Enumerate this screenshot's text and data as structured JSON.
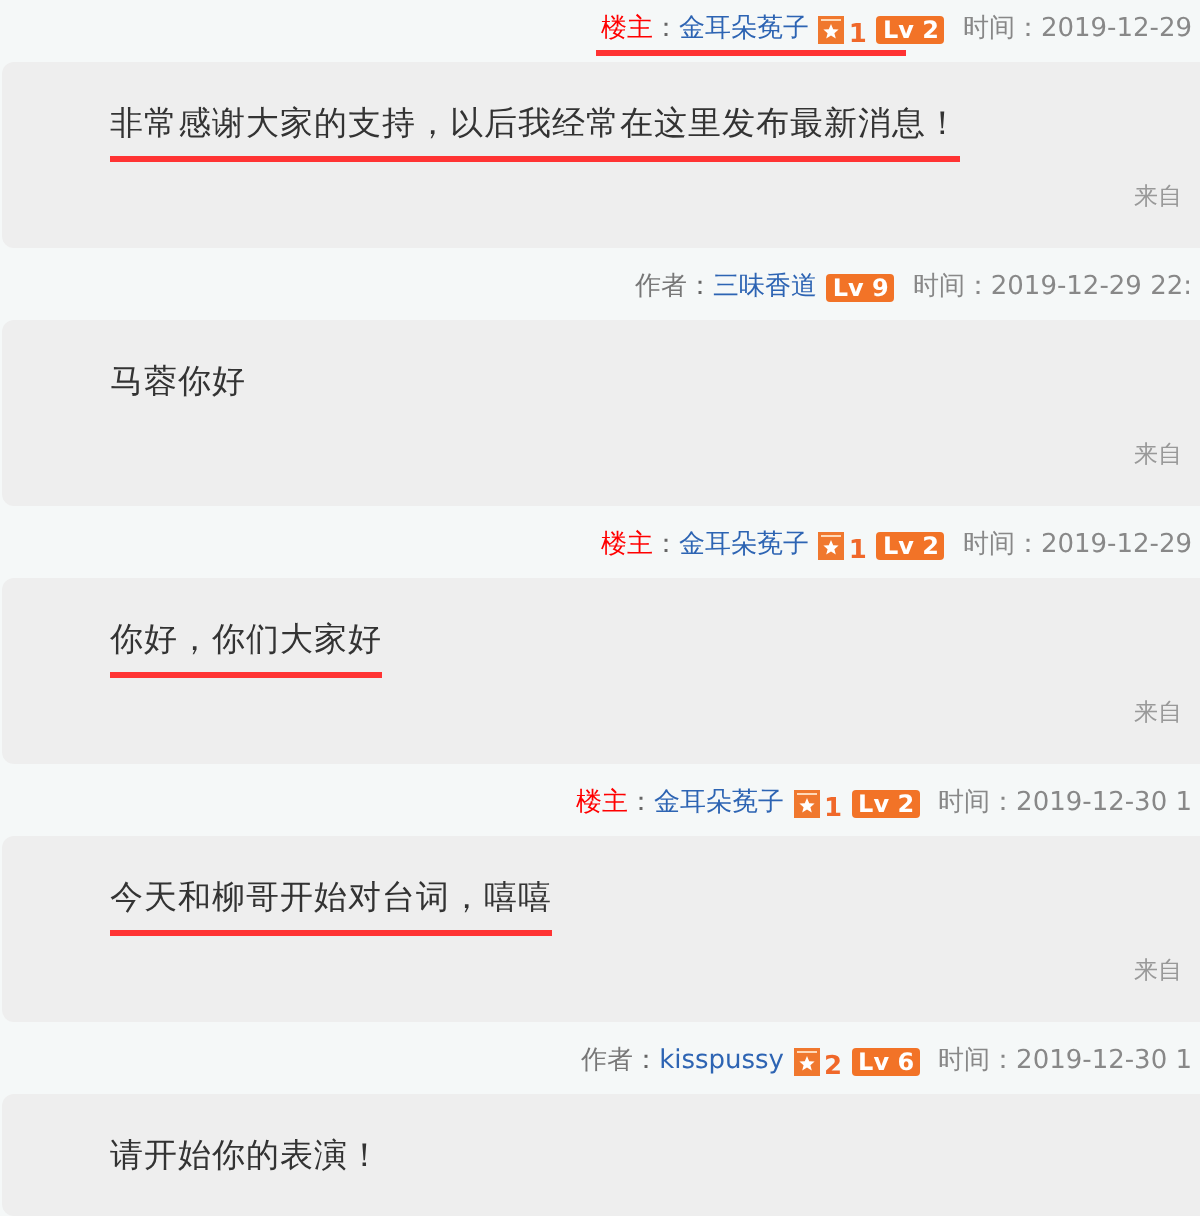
{
  "posts": [
    {
      "header": {
        "role": "楼主",
        "kind": "owner",
        "separator": "：",
        "user": "金耳朵莬子",
        "star_count": "1",
        "level": "Lv 2",
        "time_label": "时间：",
        "time": "2019-12-29",
        "underlined": true
      },
      "message": {
        "text": "非常感谢大家的支持，以后我经常在这里发布最新消息！",
        "underlined": true
      },
      "source": "来自"
    },
    {
      "header": {
        "role": "作者",
        "kind": "author",
        "separator": "：",
        "user": "三味香道",
        "level": "Lv 9",
        "time_label": "时间：",
        "time": "2019-12-29 22:",
        "underlined": false
      },
      "message": {
        "text": "马蓉你好",
        "underlined": false
      },
      "source": "来自"
    },
    {
      "header": {
        "role": "楼主",
        "kind": "owner",
        "separator": "：",
        "user": "金耳朵莬子",
        "star_count": "1",
        "level": "Lv 2",
        "time_label": "时间：",
        "time": "2019-12-29",
        "underlined": false
      },
      "message": {
        "text": "你好，你们大家好",
        "underlined": true
      },
      "source": "来自"
    },
    {
      "header": {
        "role": "楼主",
        "kind": "owner",
        "separator": "：",
        "user": "金耳朵莬子",
        "star_count": "1",
        "level": "Lv 2",
        "time_label": "时间：",
        "time": "2019-12-30 1",
        "underlined": false
      },
      "message": {
        "text": "今天和柳哥开始对台词，嘻嘻",
        "underlined": true
      },
      "source": "来自"
    },
    {
      "header": {
        "role": "作者",
        "kind": "author",
        "separator": "：",
        "user": "kisspussy",
        "star_count": "2",
        "level": "Lv 6",
        "time_label": "时间：",
        "time": "2019-12-30 1",
        "underlined": false
      },
      "message": {
        "text": "请开始你的表演！",
        "underlined": false
      }
    }
  ]
}
